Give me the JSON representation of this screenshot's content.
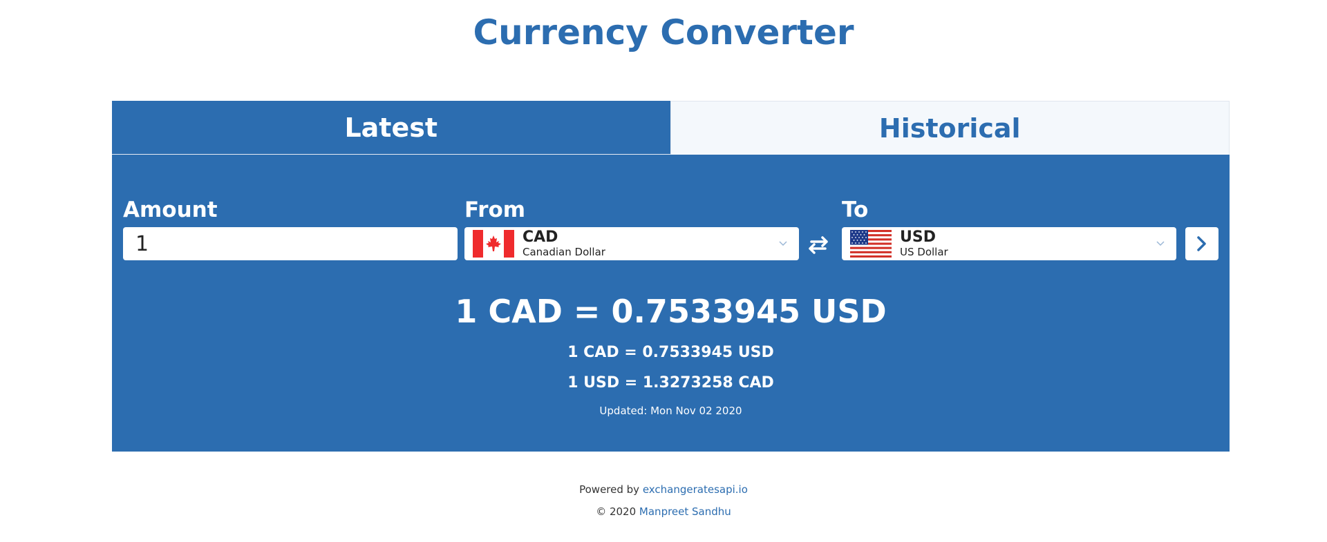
{
  "title": "Currency Converter",
  "tabs": [
    {
      "label": "Latest",
      "active": true
    },
    {
      "label": "Historical",
      "active": false
    }
  ],
  "form": {
    "amount_label": "Amount",
    "amount_value": "1",
    "from_label": "From",
    "to_label": "To",
    "from": {
      "code": "CAD",
      "name": "Canadian Dollar",
      "flag_icon": "canada-flag-icon"
    },
    "to": {
      "code": "USD",
      "name": "US Dollar",
      "flag_icon": "us-flag-icon"
    }
  },
  "result": {
    "main": "1 CAD = 0.7533945 USD",
    "line1": "1 CAD = 0.7533945 USD",
    "line2": "1 USD = 1.3273258 CAD",
    "updated": "Updated: Mon Nov 02 2020"
  },
  "footer": {
    "powered_prefix": "Powered by ",
    "powered_link": "exchangeratesapi.io",
    "copyright_prefix": "© 2020 ",
    "author_link": "Manpreet Sandhu"
  },
  "colors": {
    "primary": "#2c6db0",
    "inactive_tab_bg": "#f4f8fc"
  }
}
